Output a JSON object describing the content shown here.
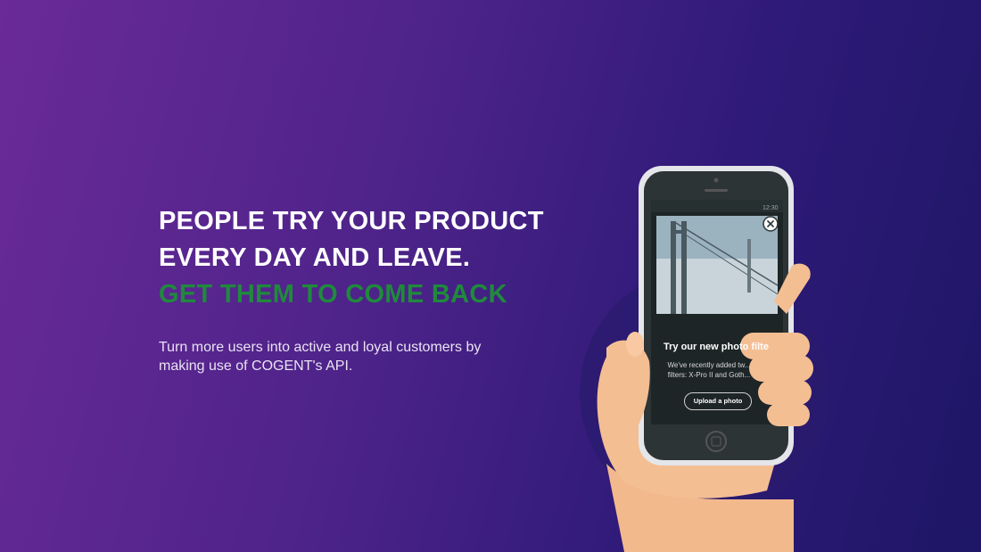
{
  "hero": {
    "headline_line1": "PEOPLE TRY YOUR PRODUCT",
    "headline_line2": "EVERY DAY AND LEAVE.",
    "headline_accent": "GET THEM TO COME BACK",
    "subtext": "Turn more users into active and loyal customers by making use of COGENT's API."
  },
  "phone": {
    "status_time": "12:30",
    "popup_title": "Try our new photo filte",
    "popup_body": "We've recently added tw... filters: X-Pro II and Goth...",
    "popup_button": "Upload a photo",
    "close_icon": "close-icon"
  },
  "colors": {
    "accent_green": "#1f8a3c",
    "bg_start": "#6a2a98",
    "bg_end": "#1e1666"
  }
}
